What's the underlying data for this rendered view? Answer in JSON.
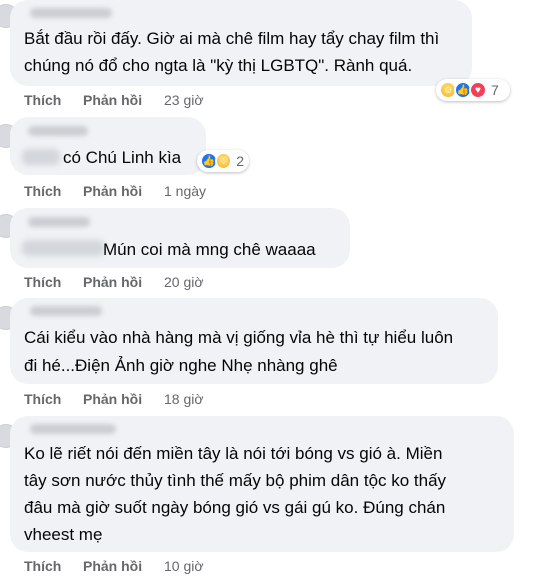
{
  "labels": {
    "like": "Thích",
    "reply": "Phản hồi"
  },
  "colors": {
    "bubble": "#f0f2f5",
    "meta": "#65676b",
    "like_reaction": "#1877f2",
    "love_reaction": "#f33e58",
    "haha_reaction": "#f7b125"
  },
  "comments": [
    {
      "lines": [
        "Bắt đầu rồi đấy. Giờ ai mà chê film hay tẩy chay film thì",
        "chúng nó đổ cho ngta là \"kỳ thị LGBTQ\". Rành quá."
      ],
      "time": "23 giờ",
      "reactions": {
        "icons": [
          "haha-icon",
          "like-icon",
          "love-icon"
        ],
        "count": "7"
      }
    },
    {
      "lines": [
        "có Chú Linh kìa"
      ],
      "time": "1 ngày",
      "reactions": {
        "icons": [
          "like-icon",
          "care-icon"
        ],
        "count": "2"
      }
    },
    {
      "lines": [
        "Mún coi mà mng chê waaaa"
      ],
      "time": "20 giờ"
    },
    {
      "lines": [
        "Cái kiểu vào nhà hàng mà vị giống vỉa hè thì tự hiểu luôn",
        "đi hé...Điện Ảnh giờ nghe Nhẹ nhàng ghê"
      ],
      "time": "18 giờ"
    },
    {
      "lines": [
        "Ko lẽ riết nói đến miền tây là nói tới bóng vs gió à. Miền",
        "tây sơn nước thủy tình thế mấy bộ phim dân tộc ko thấy",
        "đâu mà giờ suốt ngày bóng gió vs gái gú ko. Đúng chán",
        "vheest mẹ"
      ],
      "time": "10 giờ"
    }
  ]
}
